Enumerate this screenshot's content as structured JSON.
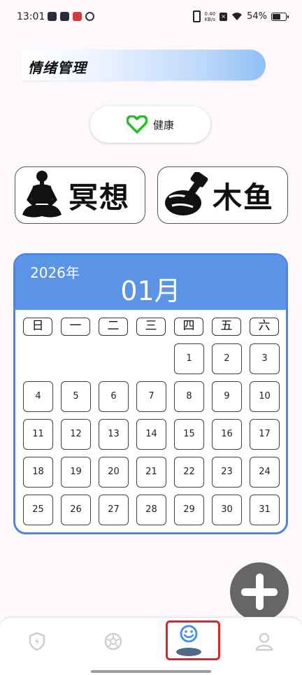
{
  "status_bar": {
    "time": "13:01",
    "net_speed_value": "0.40",
    "net_speed_unit": "KB/s",
    "battery": "54%"
  },
  "header": {
    "title": "情绪管理"
  },
  "health": {
    "label": "健康",
    "icon": "heart-icon",
    "icon_color": "#1ec21e"
  },
  "features": [
    {
      "label": "冥想",
      "icon": "meditation-person-icon"
    },
    {
      "label": "木鱼",
      "icon": "wooden-fish-mallet-icon"
    }
  ],
  "calendar": {
    "year": "2026年",
    "month": "01月",
    "weekdays": [
      "日",
      "一",
      "二",
      "三",
      "四",
      "五",
      "六"
    ],
    "first_weekday_index": 4,
    "days": [
      "1",
      "2",
      "3",
      "4",
      "5",
      "6",
      "7",
      "8",
      "9",
      "10",
      "11",
      "12",
      "13",
      "14",
      "15",
      "16",
      "17",
      "18",
      "19",
      "20",
      "21",
      "22",
      "23",
      "24",
      "25",
      "26",
      "27",
      "28",
      "29",
      "30",
      "31"
    ]
  },
  "fab": {
    "icon": "plus-icon"
  },
  "bottom_nav": {
    "items": [
      {
        "icon": "shield-icon",
        "active": false
      },
      {
        "icon": "aperture-icon",
        "active": false
      },
      {
        "icon": "smiley-icon",
        "active": true
      },
      {
        "icon": "person-icon",
        "active": false
      }
    ],
    "accent_color": "#3d8fe8",
    "highlight_color": "#d8262a"
  }
}
